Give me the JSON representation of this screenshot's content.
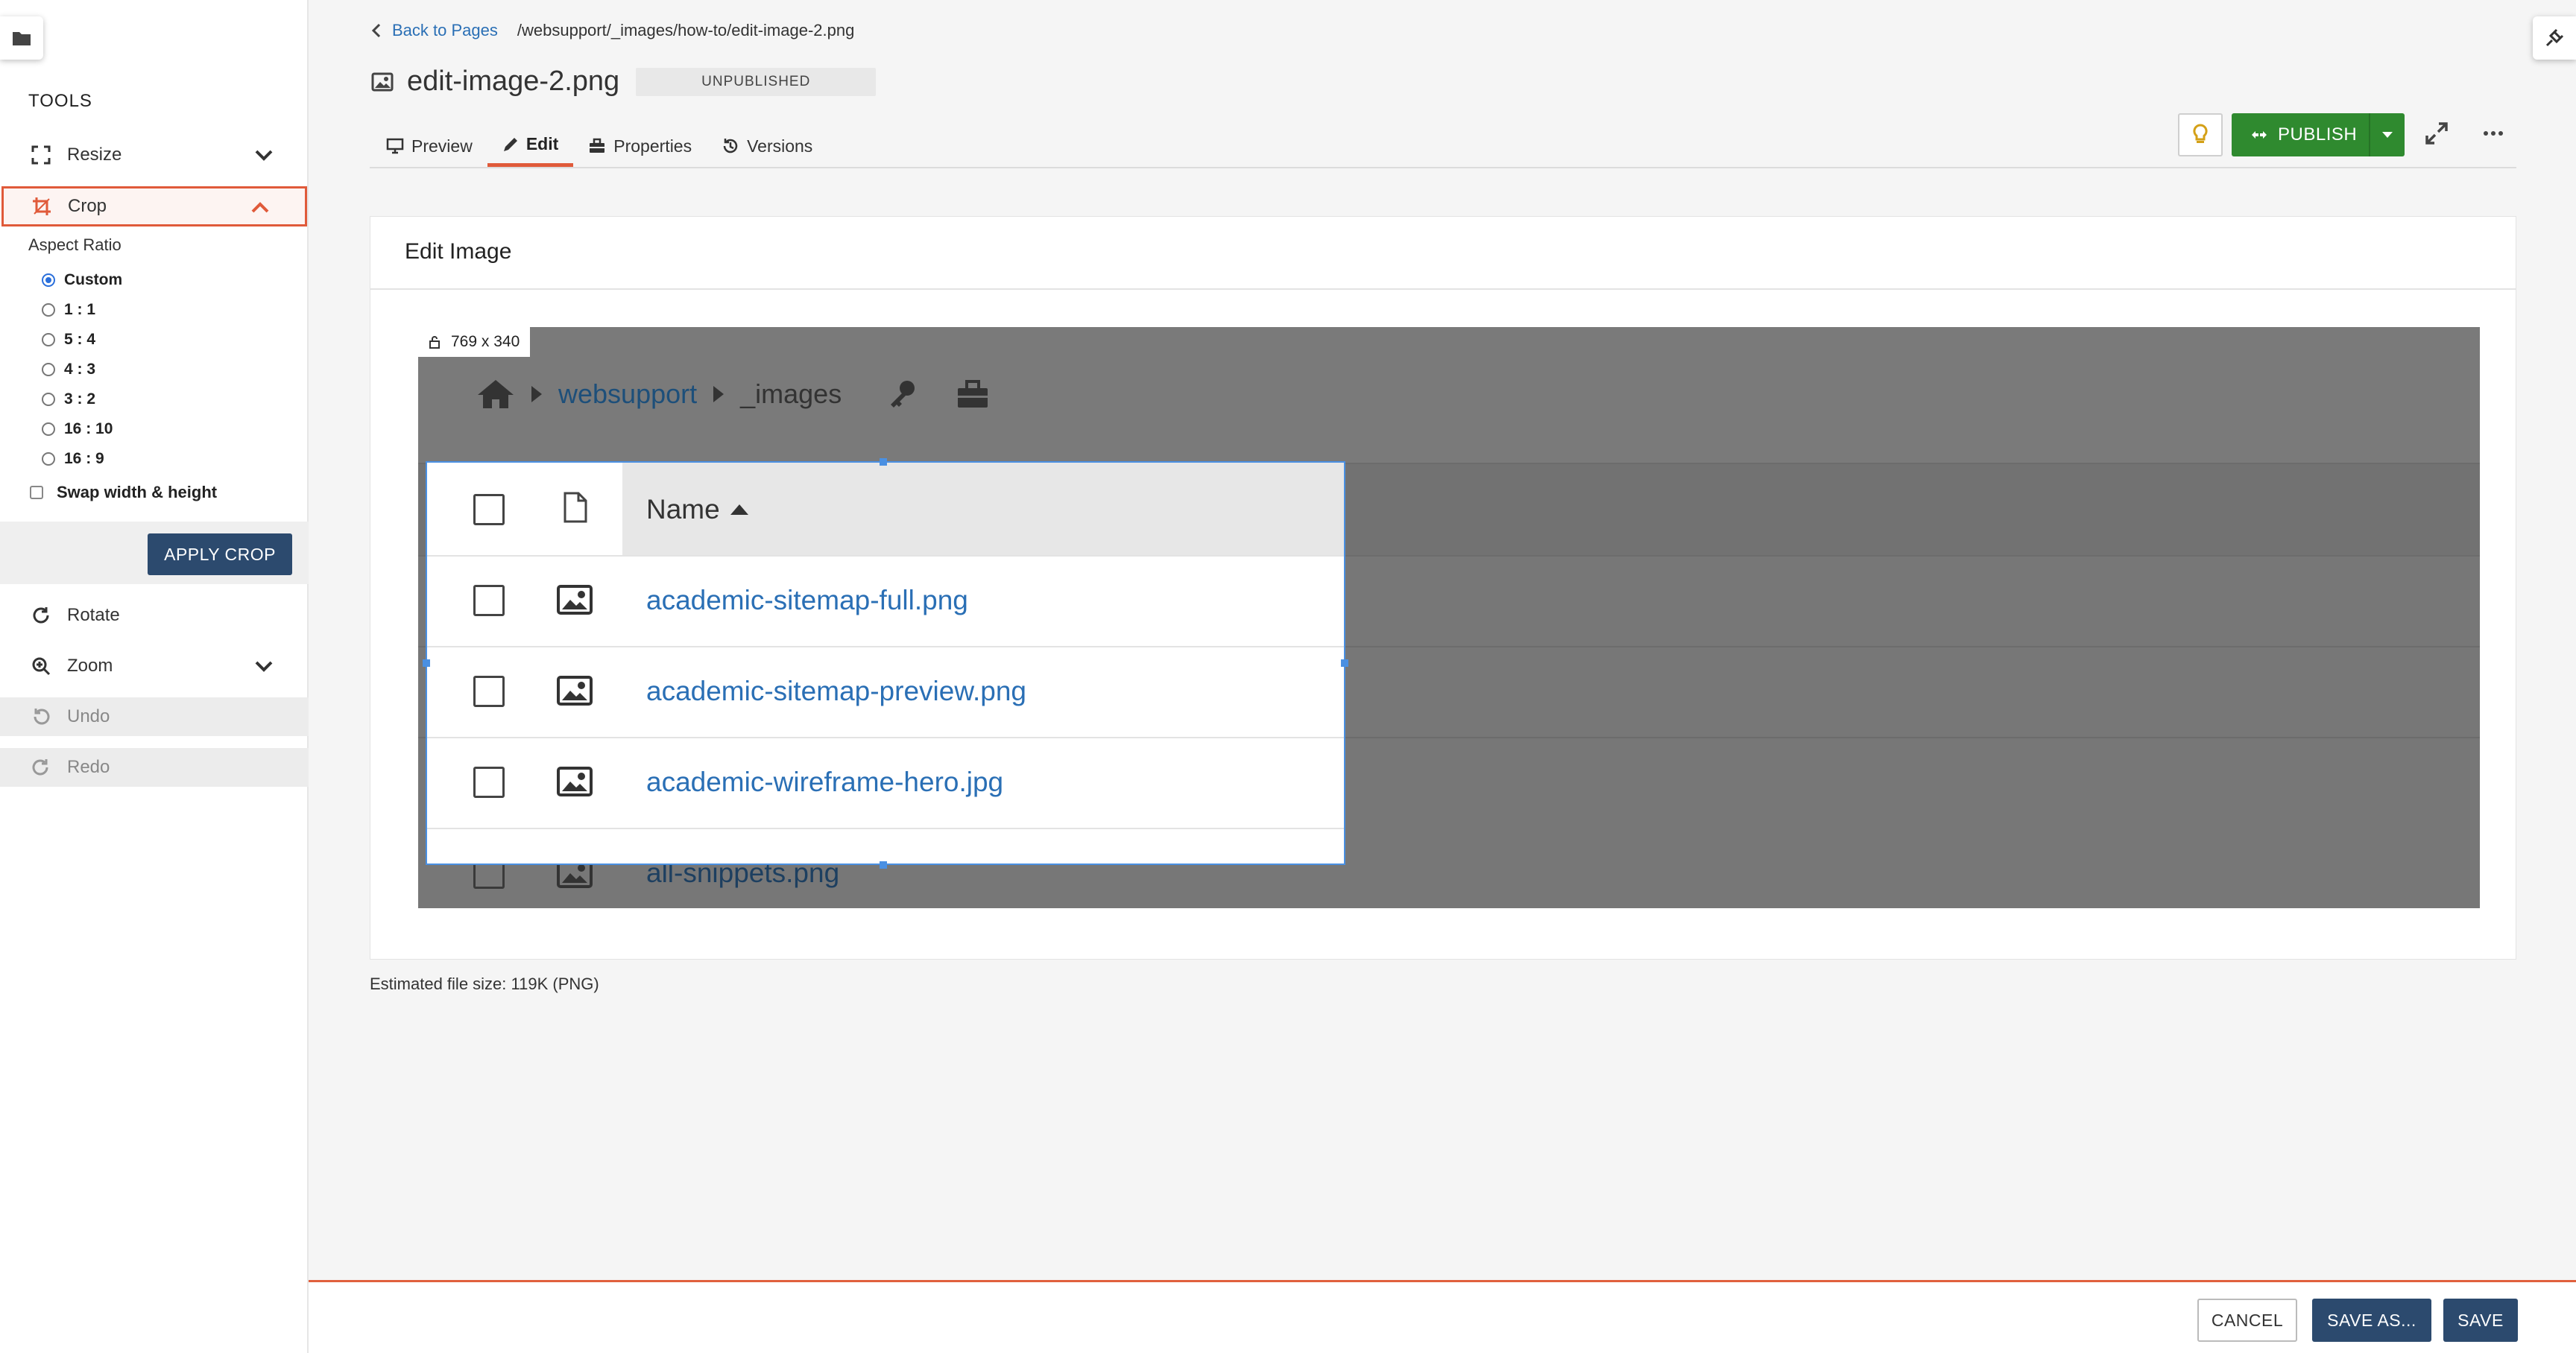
{
  "tools": {
    "heading": "TOOLS",
    "resize": "Resize",
    "crop": "Crop",
    "aspect_label": "Aspect Ratio",
    "ratios": [
      "Custom",
      "1 : 1",
      "5 : 4",
      "4 : 3",
      "3 : 2",
      "16 : 10",
      "16 : 9"
    ],
    "selected_ratio": "Custom",
    "swap": "Swap width & height",
    "apply_crop": "APPLY CROP",
    "rotate": "Rotate",
    "zoom": "Zoom",
    "undo": "Undo",
    "redo": "Redo"
  },
  "header": {
    "back": "Back to Pages",
    "path": "/websupport/_images/how-to/edit-image-2.png",
    "title": "edit-image-2.png",
    "status": "UNPUBLISHED",
    "tabs": [
      "Preview",
      "Edit",
      "Properties",
      "Versions"
    ],
    "active_tab": "Edit",
    "publish": "PUBLISH"
  },
  "card": {
    "title": "Edit Image",
    "dimensions": "769 x 340"
  },
  "image": {
    "crumb_site": "websupport",
    "crumb_folder": "_images",
    "column_name": "Name",
    "files": [
      "academic-sitemap-full.png",
      "academic-sitemap-preview.png",
      "academic-wireframe-hero.jpg",
      "all-snippets.png"
    ]
  },
  "file_size": "Estimated file size: 119K (PNG)",
  "footer": {
    "cancel": "CANCEL",
    "save_as": "SAVE AS...",
    "save": "SAVE"
  },
  "colors": {
    "accent": "#e05a3a",
    "publish": "#2f8a2f",
    "primary": "#2c4a6e",
    "link": "#2a6fb5",
    "crop_border": "#4a90e2"
  }
}
